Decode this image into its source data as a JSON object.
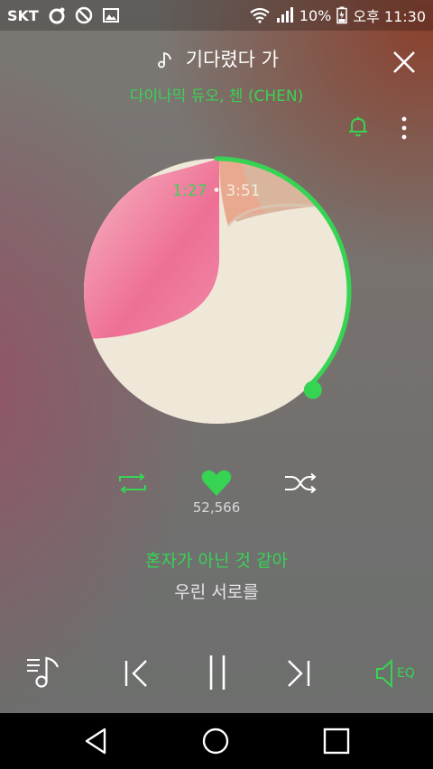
{
  "status_bar": {
    "carrier": "SKT",
    "battery_percent": "10%",
    "clock": "오후 11:30"
  },
  "track": {
    "title": "기다렸다 가",
    "artist": "다이나믹 듀오, 첸 (CHEN)"
  },
  "playback": {
    "current_time": "1:27",
    "separator": "•",
    "total_time": "3:51",
    "progress_fraction": 0.377
  },
  "actions": {
    "like_count": "52,566"
  },
  "lyrics": {
    "current_line": "혼자가 아닌 것 같아",
    "next_line": "우린 서로를"
  },
  "controls": {
    "eq_label": "EQ"
  },
  "colors": {
    "accent": "#37d454",
    "text_primary": "#ffffff",
    "text_secondary": "#d9d9d9"
  },
  "icons": {
    "close": "close-icon",
    "bell": "bell-icon",
    "more": "more-vertical-icon",
    "repeat": "repeat-icon",
    "like": "heart-icon",
    "shuffle": "shuffle-icon",
    "playlist": "playlist-icon",
    "previous": "previous-track-icon",
    "pause": "pause-icon",
    "next": "next-track-icon",
    "eq": "equalizer-speaker-icon"
  }
}
